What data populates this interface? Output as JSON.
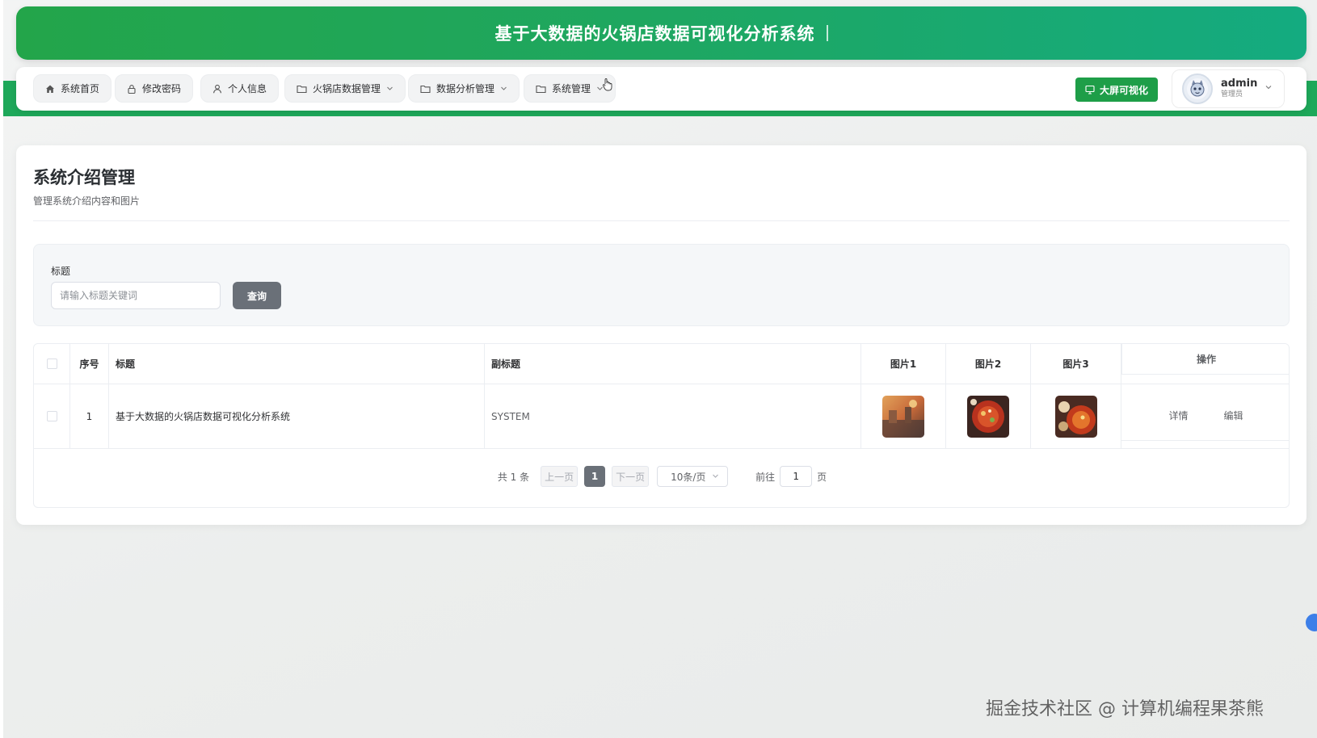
{
  "app": {
    "title": "基于大数据的火锅店数据可视化分析系统"
  },
  "nav": {
    "items": [
      {
        "label": "系统首页",
        "icon": "home-icon"
      },
      {
        "label": "修改密码",
        "icon": "lock-icon"
      },
      {
        "label": "个人信息",
        "icon": "user-icon"
      },
      {
        "label": "火锅店数据管理",
        "icon": "folder-icon",
        "has_dropdown": true
      },
      {
        "label": "数据分析管理",
        "icon": "folder-icon",
        "has_dropdown": true
      },
      {
        "label": "系统管理",
        "icon": "folder-icon",
        "has_dropdown": true
      }
    ],
    "big_screen_label": "大屏可视化"
  },
  "user": {
    "name": "admin",
    "role": "管理员"
  },
  "page": {
    "title": "系统介绍管理",
    "subtitle": "管理系统介绍内容和图片"
  },
  "search": {
    "label": "标题",
    "placeholder": "请输入标题关键词",
    "value": "",
    "button": "查询"
  },
  "table": {
    "columns": [
      "序号",
      "标题",
      "副标题",
      "图片1",
      "图片2",
      "图片3",
      "操作"
    ],
    "rows": [
      {
        "index": "1",
        "title": "基于大数据的火锅店数据可视化分析系统",
        "subtitle": "SYSTEM",
        "actions": [
          "详情",
          "编辑"
        ]
      }
    ]
  },
  "pagination": {
    "total_text": "共 1 条",
    "prev": "上一页",
    "current": "1",
    "next": "下一页",
    "page_size": "10条/页",
    "goto_label": "前往",
    "goto_value": "1",
    "page_suffix": "页"
  },
  "watermark": "掘金技术社区 @ 计算机编程果茶熊",
  "colors": {
    "brand_green": "#1ea85a",
    "button_gray": "#6a7078"
  }
}
